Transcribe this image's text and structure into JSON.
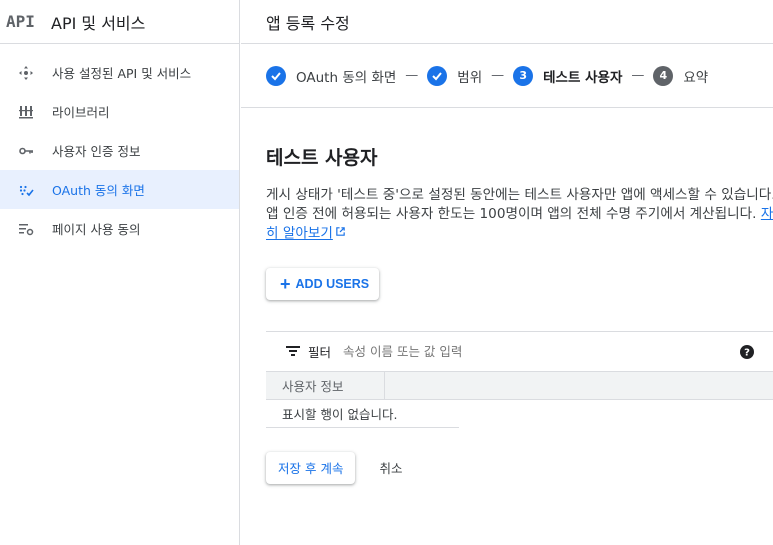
{
  "sidebar": {
    "logo": "API",
    "title": "API 및 서비스",
    "items": [
      {
        "label": "사용 설정된 API 및 서비스",
        "icon": "enabled-apis-icon",
        "active": false
      },
      {
        "label": "라이브러리",
        "icon": "library-icon",
        "active": false
      },
      {
        "label": "사용자 인증 정보",
        "icon": "key-icon",
        "active": false
      },
      {
        "label": "OAuth 동의 화면",
        "icon": "oauth-consent-icon",
        "active": true
      },
      {
        "label": "페이지 사용 동의",
        "icon": "page-usage-icon",
        "active": false
      }
    ]
  },
  "header": {
    "title": "앱 등록 수정"
  },
  "stepper": {
    "steps": [
      {
        "number": "1",
        "label": "OAuth 동의 화면",
        "state": "done"
      },
      {
        "number": "2",
        "label": "범위",
        "state": "done"
      },
      {
        "number": "3",
        "label": "테스트 사용자",
        "state": "current"
      },
      {
        "number": "4",
        "label": "요약",
        "state": "todo"
      }
    ],
    "separator": "—"
  },
  "section": {
    "title": "테스트 사용자",
    "description": "게시 상태가 '테스트 중'으로 설정된 동안에는 테스트 사용자만 앱에 액세스할 수 있습니다. 앱 인증 전에 허용되는 사용자 한도는 100명이며 앱의 전체 수명 주기에서 계산됩니다.",
    "learn_more": "자세히 알아보기"
  },
  "add_users": {
    "plus": "+",
    "label": "ADD USERS"
  },
  "table": {
    "filter_label": "필터",
    "filter_placeholder": "속성 이름 또는 값 입력",
    "help": "?",
    "columns": [
      "사용자 정보"
    ],
    "empty_message": "표시할 행이 없습니다."
  },
  "actions": {
    "save": "저장 후 계속",
    "cancel": "취소"
  },
  "colors": {
    "accent": "#1a73e8",
    "active_bg": "#e8f0fe",
    "border": "#dadce0"
  }
}
